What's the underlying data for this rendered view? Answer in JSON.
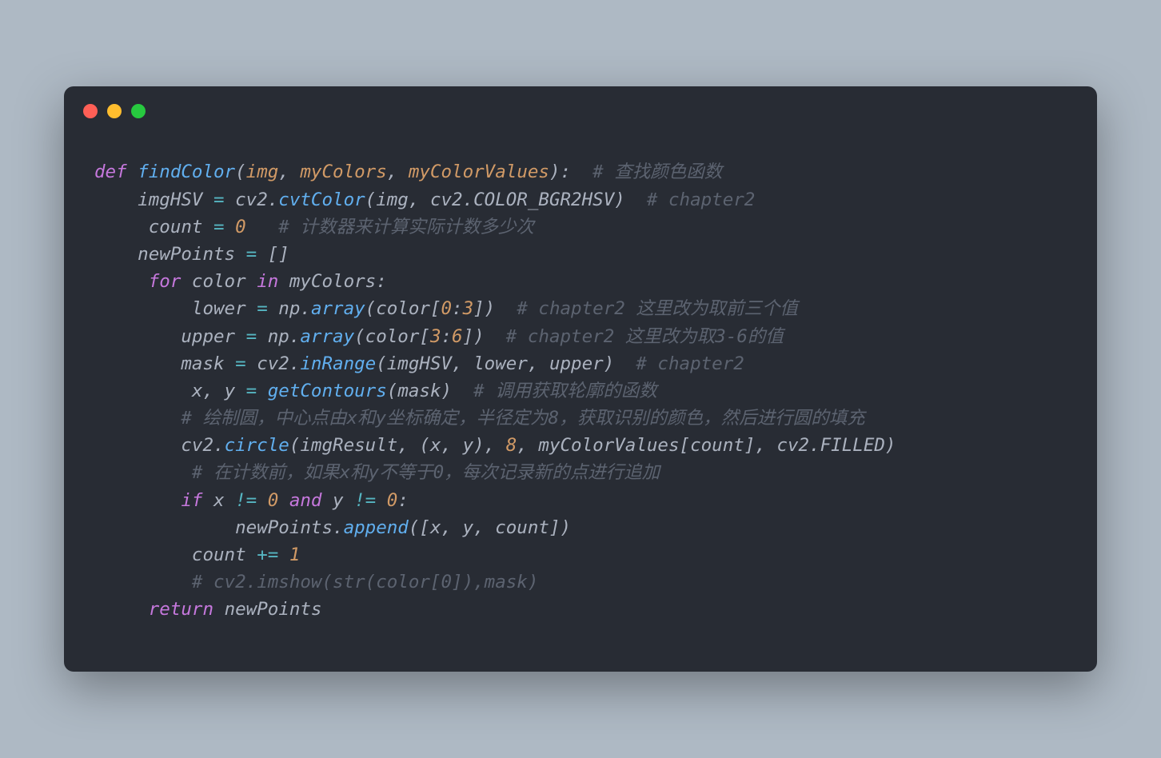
{
  "window": {
    "traffic_lights": [
      "close",
      "minimize",
      "zoom"
    ]
  },
  "code": {
    "language": "python",
    "tokens": [
      [
        {
          "t": "def ",
          "c": "kw"
        },
        {
          "t": "findColor",
          "c": "fn"
        },
        {
          "t": "(",
          "c": "punc"
        },
        {
          "t": "img",
          "c": "param"
        },
        {
          "t": ", ",
          "c": "punc"
        },
        {
          "t": "myColors",
          "c": "param"
        },
        {
          "t": ", ",
          "c": "punc"
        },
        {
          "t": "myColorValues",
          "c": "param"
        },
        {
          "t": "):",
          "c": "punc"
        },
        {
          "t": "  ",
          "c": "punc"
        },
        {
          "t": "# 查找颜色函数",
          "c": "cmt"
        }
      ],
      [
        {
          "t": "    imgHSV ",
          "c": "var"
        },
        {
          "t": "= ",
          "c": "op"
        },
        {
          "t": "cv2",
          "c": "var"
        },
        {
          "t": ".",
          "c": "punc"
        },
        {
          "t": "cvtColor",
          "c": "fn"
        },
        {
          "t": "(",
          "c": "punc"
        },
        {
          "t": "img",
          "c": "var"
        },
        {
          "t": ", ",
          "c": "punc"
        },
        {
          "t": "cv2",
          "c": "var"
        },
        {
          "t": ".",
          "c": "punc"
        },
        {
          "t": "COLOR_BGR2HSV",
          "c": "var"
        },
        {
          "t": ")",
          "c": "punc"
        },
        {
          "t": "  ",
          "c": "punc"
        },
        {
          "t": "# chapter2",
          "c": "cmt"
        }
      ],
      [
        {
          "t": "     count ",
          "c": "var"
        },
        {
          "t": "= ",
          "c": "op"
        },
        {
          "t": "0",
          "c": "num"
        },
        {
          "t": "   ",
          "c": "punc"
        },
        {
          "t": "# 计数器来计算实际计数多少次",
          "c": "cmt"
        }
      ],
      [
        {
          "t": "    newPoints ",
          "c": "var"
        },
        {
          "t": "= ",
          "c": "op"
        },
        {
          "t": "[]",
          "c": "punc"
        }
      ],
      [
        {
          "t": "     ",
          "c": "punc"
        },
        {
          "t": "for ",
          "c": "kw"
        },
        {
          "t": "color ",
          "c": "var"
        },
        {
          "t": "in ",
          "c": "kw"
        },
        {
          "t": "myColors",
          "c": "var"
        },
        {
          "t": ":",
          "c": "punc"
        }
      ],
      [
        {
          "t": "         lower ",
          "c": "var"
        },
        {
          "t": "= ",
          "c": "op"
        },
        {
          "t": "np",
          "c": "var"
        },
        {
          "t": ".",
          "c": "punc"
        },
        {
          "t": "array",
          "c": "fn"
        },
        {
          "t": "(",
          "c": "punc"
        },
        {
          "t": "color",
          "c": "var"
        },
        {
          "t": "[",
          "c": "punc"
        },
        {
          "t": "0",
          "c": "num"
        },
        {
          "t": ":",
          "c": "punc"
        },
        {
          "t": "3",
          "c": "num"
        },
        {
          "t": "])",
          "c": "punc"
        },
        {
          "t": "  ",
          "c": "punc"
        },
        {
          "t": "# chapter2 这里改为取前三个值",
          "c": "cmt"
        }
      ],
      [
        {
          "t": "        upper ",
          "c": "var"
        },
        {
          "t": "= ",
          "c": "op"
        },
        {
          "t": "np",
          "c": "var"
        },
        {
          "t": ".",
          "c": "punc"
        },
        {
          "t": "array",
          "c": "fn"
        },
        {
          "t": "(",
          "c": "punc"
        },
        {
          "t": "color",
          "c": "var"
        },
        {
          "t": "[",
          "c": "punc"
        },
        {
          "t": "3",
          "c": "num"
        },
        {
          "t": ":",
          "c": "punc"
        },
        {
          "t": "6",
          "c": "num"
        },
        {
          "t": "])",
          "c": "punc"
        },
        {
          "t": "  ",
          "c": "punc"
        },
        {
          "t": "# chapter2 这里改为取3-6的值",
          "c": "cmt"
        }
      ],
      [
        {
          "t": "        mask ",
          "c": "var"
        },
        {
          "t": "= ",
          "c": "op"
        },
        {
          "t": "cv2",
          "c": "var"
        },
        {
          "t": ".",
          "c": "punc"
        },
        {
          "t": "inRange",
          "c": "fn"
        },
        {
          "t": "(",
          "c": "punc"
        },
        {
          "t": "imgHSV",
          "c": "var"
        },
        {
          "t": ", ",
          "c": "punc"
        },
        {
          "t": "lower",
          "c": "var"
        },
        {
          "t": ", ",
          "c": "punc"
        },
        {
          "t": "upper",
          "c": "var"
        },
        {
          "t": ")",
          "c": "punc"
        },
        {
          "t": "  ",
          "c": "punc"
        },
        {
          "t": "# chapter2",
          "c": "cmt"
        }
      ],
      [
        {
          "t": "         x",
          "c": "var"
        },
        {
          "t": ", ",
          "c": "punc"
        },
        {
          "t": "y ",
          "c": "var"
        },
        {
          "t": "= ",
          "c": "op"
        },
        {
          "t": "getContours",
          "c": "fn"
        },
        {
          "t": "(",
          "c": "punc"
        },
        {
          "t": "mask",
          "c": "var"
        },
        {
          "t": ")",
          "c": "punc"
        },
        {
          "t": "  ",
          "c": "punc"
        },
        {
          "t": "# 调用获取轮廓的函数",
          "c": "cmt"
        }
      ],
      [
        {
          "t": "        ",
          "c": "punc"
        },
        {
          "t": "# 绘制圆，中心点由x和y坐标确定，半径定为8，获取识别的颜色，然后进行圆的填充",
          "c": "cmt"
        }
      ],
      [
        {
          "t": "        cv2",
          "c": "var"
        },
        {
          "t": ".",
          "c": "punc"
        },
        {
          "t": "circle",
          "c": "fn"
        },
        {
          "t": "(",
          "c": "punc"
        },
        {
          "t": "imgResult",
          "c": "var"
        },
        {
          "t": ", (",
          "c": "punc"
        },
        {
          "t": "x",
          "c": "var"
        },
        {
          "t": ", ",
          "c": "punc"
        },
        {
          "t": "y",
          "c": "var"
        },
        {
          "t": "), ",
          "c": "punc"
        },
        {
          "t": "8",
          "c": "num"
        },
        {
          "t": ", ",
          "c": "punc"
        },
        {
          "t": "myColorValues",
          "c": "var"
        },
        {
          "t": "[",
          "c": "punc"
        },
        {
          "t": "count",
          "c": "var"
        },
        {
          "t": "], ",
          "c": "punc"
        },
        {
          "t": "cv2",
          "c": "var"
        },
        {
          "t": ".",
          "c": "punc"
        },
        {
          "t": "FILLED",
          "c": "var"
        },
        {
          "t": ")",
          "c": "punc"
        }
      ],
      [
        {
          "t": "         ",
          "c": "punc"
        },
        {
          "t": "# 在计数前，如果x和y不等于0，每次记录新的点进行追加",
          "c": "cmt"
        }
      ],
      [
        {
          "t": "        ",
          "c": "punc"
        },
        {
          "t": "if ",
          "c": "kw"
        },
        {
          "t": "x ",
          "c": "var"
        },
        {
          "t": "!= ",
          "c": "op"
        },
        {
          "t": "0 ",
          "c": "num"
        },
        {
          "t": "and ",
          "c": "kw"
        },
        {
          "t": "y ",
          "c": "var"
        },
        {
          "t": "!= ",
          "c": "op"
        },
        {
          "t": "0",
          "c": "num"
        },
        {
          "t": ":",
          "c": "punc"
        }
      ],
      [
        {
          "t": "             newPoints",
          "c": "var"
        },
        {
          "t": ".",
          "c": "punc"
        },
        {
          "t": "append",
          "c": "fn"
        },
        {
          "t": "([",
          "c": "punc"
        },
        {
          "t": "x",
          "c": "var"
        },
        {
          "t": ", ",
          "c": "punc"
        },
        {
          "t": "y",
          "c": "var"
        },
        {
          "t": ", ",
          "c": "punc"
        },
        {
          "t": "count",
          "c": "var"
        },
        {
          "t": "])",
          "c": "punc"
        }
      ],
      [
        {
          "t": "         count ",
          "c": "var"
        },
        {
          "t": "+= ",
          "c": "op"
        },
        {
          "t": "1",
          "c": "num"
        }
      ],
      [
        {
          "t": "         ",
          "c": "punc"
        },
        {
          "t": "# cv2.imshow(str(color[0]),mask)",
          "c": "cmt"
        }
      ],
      [
        {
          "t": "     ",
          "c": "punc"
        },
        {
          "t": "return ",
          "c": "kw"
        },
        {
          "t": "newPoints",
          "c": "var"
        }
      ]
    ]
  }
}
